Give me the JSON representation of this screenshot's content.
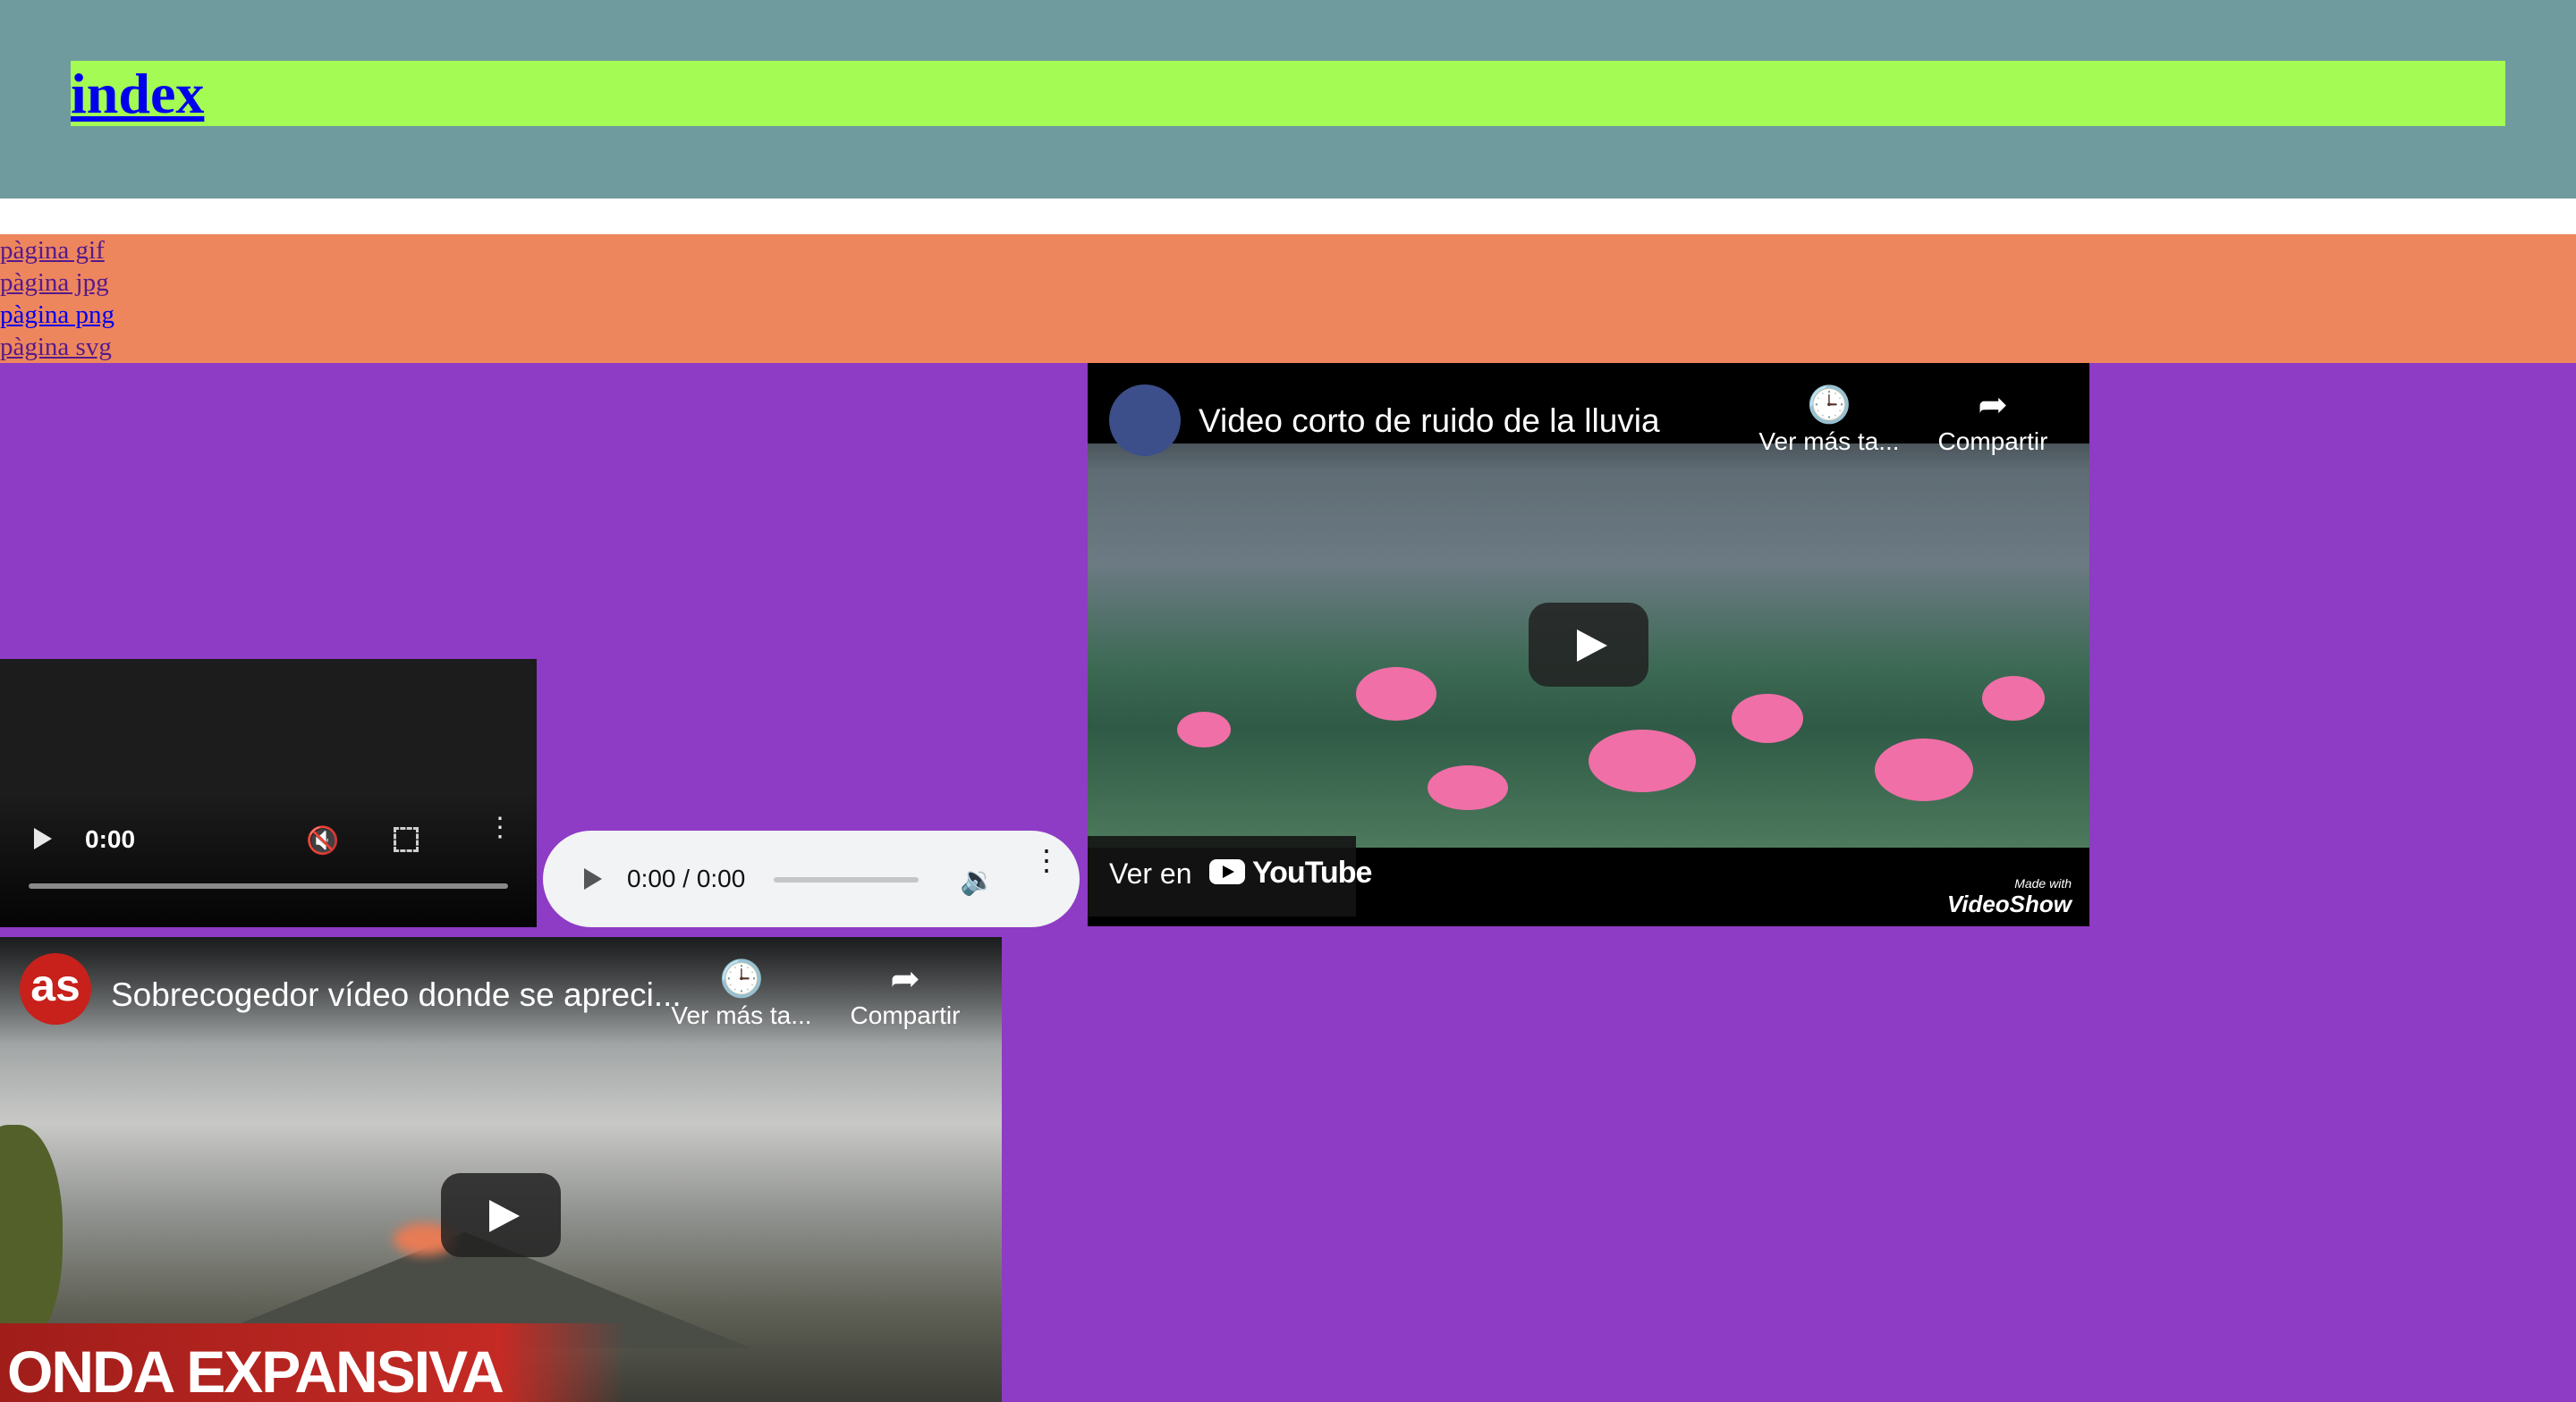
{
  "header": {
    "title": "index"
  },
  "nav": {
    "links": [
      {
        "label": "pàgina gif"
      },
      {
        "label": "pàgina jpg"
      },
      {
        "label": "pàgina png"
      },
      {
        "label": "pàgina svg"
      }
    ]
  },
  "video_player": {
    "time": "0:00"
  },
  "audio_player": {
    "time": "0:00 / 0:00"
  },
  "embeds": [
    {
      "title": "Video corto de ruido de la lluvia",
      "watch_later": "Ver más ta...",
      "share": "Compartir",
      "watch_on": "Ver en",
      "youtube": "YouTube",
      "made_with": "Made with",
      "made_with_brand": "VideoShow"
    },
    {
      "title": "Sobrecogedor vídeo donde se apreci...",
      "channel_logo": "as",
      "watch_later": "Ver más ta...",
      "share": "Compartir",
      "banner": "ONDA EXPANSIVA"
    }
  ],
  "colors": {
    "header_bg": "#6f9b9e",
    "title_bg": "#a3fb53",
    "nav_bg": "#ee865d",
    "body_bg": "#8e3bc6"
  }
}
